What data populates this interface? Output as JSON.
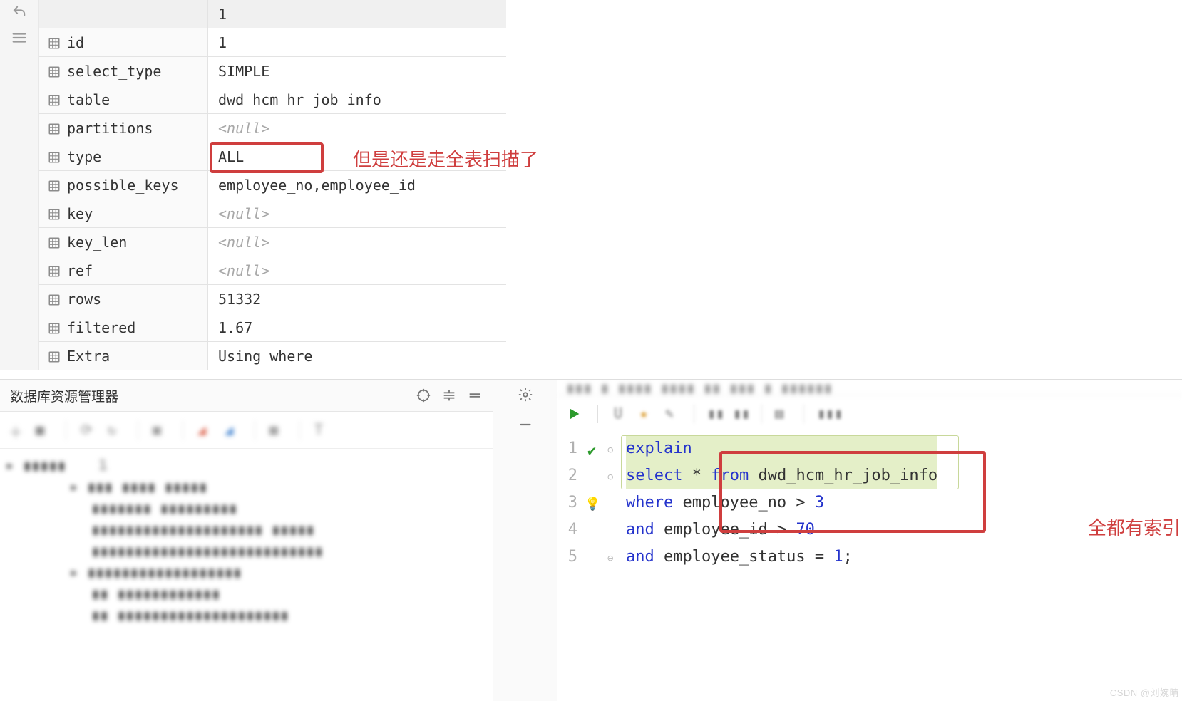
{
  "results": {
    "column_header": "1",
    "rows": [
      {
        "field": "id",
        "value": "1",
        "null": false
      },
      {
        "field": "select_type",
        "value": "SIMPLE",
        "null": false
      },
      {
        "field": "table",
        "value": "dwd_hcm_hr_job_info",
        "null": false
      },
      {
        "field": "partitions",
        "value": "<null>",
        "null": true
      },
      {
        "field": "type",
        "value": "ALL",
        "null": false
      },
      {
        "field": "possible_keys",
        "value": "employee_no,employee_id",
        "null": false
      },
      {
        "field": "key",
        "value": "<null>",
        "null": true
      },
      {
        "field": "key_len",
        "value": "<null>",
        "null": true
      },
      {
        "field": "ref",
        "value": "<null>",
        "null": true
      },
      {
        "field": "rows",
        "value": "51332",
        "null": false
      },
      {
        "field": "filtered",
        "value": "1.67",
        "null": false
      },
      {
        "field": "Extra",
        "value": "Using where",
        "null": false
      }
    ]
  },
  "annotations": {
    "full_scan": "但是还是走全表扫描了",
    "all_indexed": "全都有索引"
  },
  "db_explorer": {
    "title": "数据库资源管理器"
  },
  "sql": {
    "lines": [
      [
        {
          "cls": "kw",
          "t": "explain"
        }
      ],
      [
        {
          "cls": "kw",
          "t": "select"
        },
        {
          "cls": "",
          "t": " * "
        },
        {
          "cls": "kw",
          "t": "from"
        },
        {
          "cls": "",
          "t": " dwd_hcm_hr_job_info"
        }
      ],
      [
        {
          "cls": "kw",
          "t": "where"
        },
        {
          "cls": "",
          "t": " employee_no > "
        },
        {
          "cls": "num",
          "t": "3"
        }
      ],
      [
        {
          "cls": "kw",
          "t": "and"
        },
        {
          "cls": "",
          "t": " employee_id > "
        },
        {
          "cls": "num",
          "t": "70"
        }
      ],
      [
        {
          "cls": "kw",
          "t": "and"
        },
        {
          "cls": "",
          "t": " employee_status = "
        },
        {
          "cls": "num",
          "t": "1"
        },
        {
          "cls": "",
          "t": ";"
        }
      ]
    ],
    "line_numbers": [
      "1",
      "2",
      "3",
      "4",
      "5"
    ]
  },
  "watermark": "CSDN @刘婉晴"
}
